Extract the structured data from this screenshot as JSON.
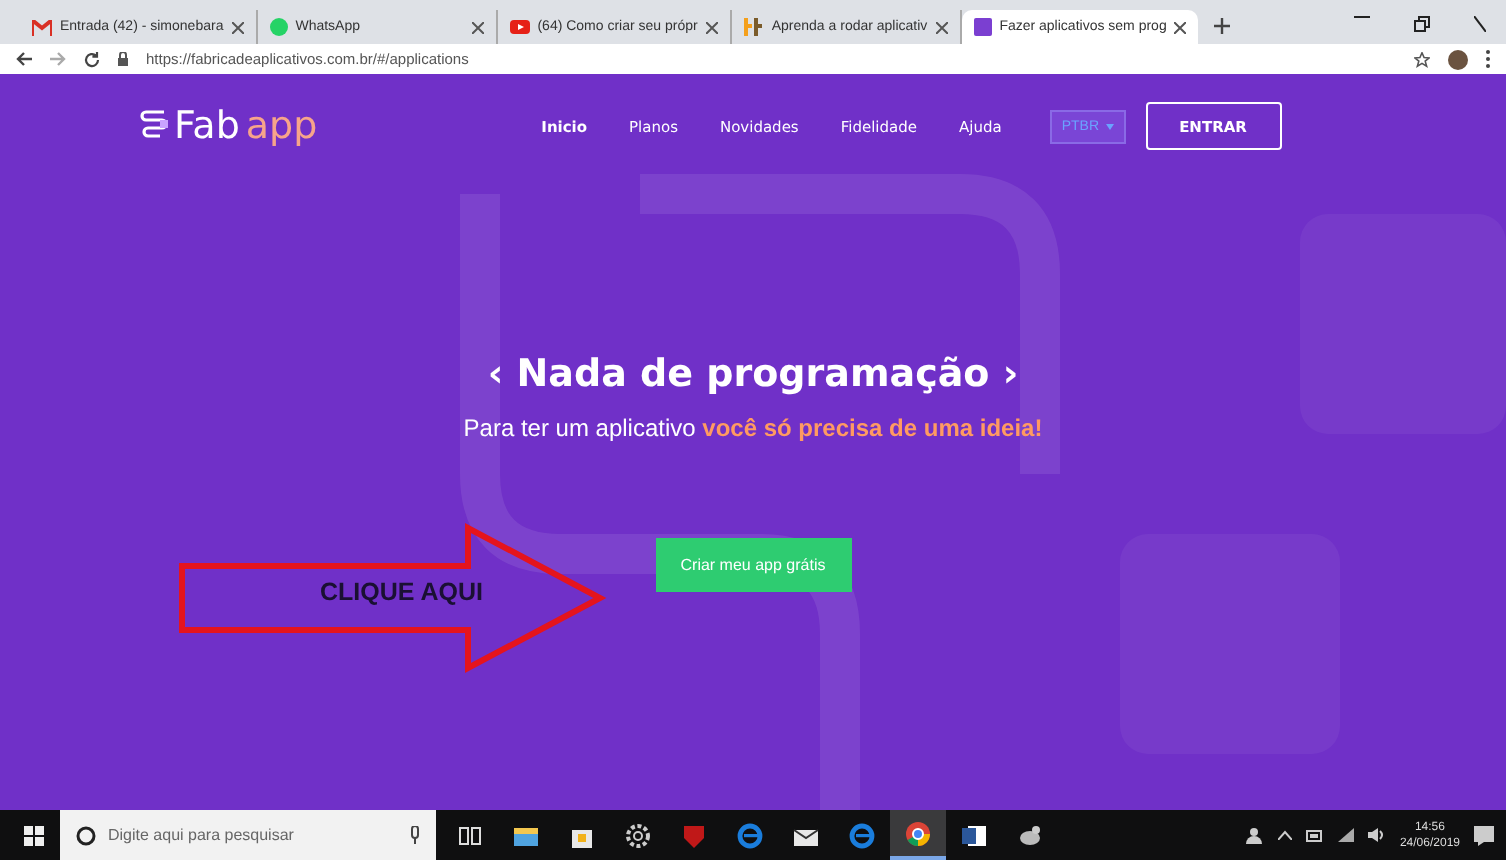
{
  "browser": {
    "tabs": [
      {
        "title": "Entrada (42) - simonebara",
        "kind": "mail",
        "selected": false
      },
      {
        "title": "WhatsApp",
        "kind": "chat",
        "selected": false
      },
      {
        "title": "(64) Como criar seu própr",
        "kind": "video",
        "selected": false
      },
      {
        "title": "Aprenda a rodar aplicativ",
        "kind": "blog",
        "selected": false
      },
      {
        "title": "Fazer aplicativos sem prog",
        "kind": "app",
        "selected": true
      }
    ],
    "address": "https://fabricadeaplicativos.com.br/#/applications"
  },
  "site": {
    "logo": {
      "first": "Fab",
      "second": "app"
    },
    "nav": [
      {
        "label": "Inicio",
        "selected": true
      },
      {
        "label": "Planos",
        "selected": false
      },
      {
        "label": "Novidades",
        "selected": false
      },
      {
        "label": "Fidelidade",
        "selected": false
      },
      {
        "label": "Ajuda",
        "selected": false
      }
    ],
    "language": "PTBR",
    "login": "ENTRAR"
  },
  "hero": {
    "title": "‹ Nada de programação ›",
    "subtitle": "Para ter um aplicativo **você só precisa de uma ideia!**",
    "cta": "Criar meu app grátis"
  },
  "annotation": {
    "label": "CLIQUE AQUI"
  },
  "taskbar": {
    "search": {
      "placeholder": "Digite aqui para pesquisar"
    },
    "apps": [
      {
        "kind": "taskview",
        "active": false
      },
      {
        "kind": "folder",
        "active": false
      },
      {
        "kind": "store",
        "active": false
      },
      {
        "kind": "gear",
        "active": false
      },
      {
        "kind": "shield",
        "active": false
      },
      {
        "kind": "edge",
        "active": false
      },
      {
        "kind": "mail",
        "active": false
      },
      {
        "kind": "edge",
        "active": false
      },
      {
        "kind": "chrome",
        "active": true
      },
      {
        "kind": "word",
        "active": false
      },
      {
        "kind": "bird",
        "active": false
      }
    ],
    "time": "14:56",
    "date": "24/06/2019"
  }
}
